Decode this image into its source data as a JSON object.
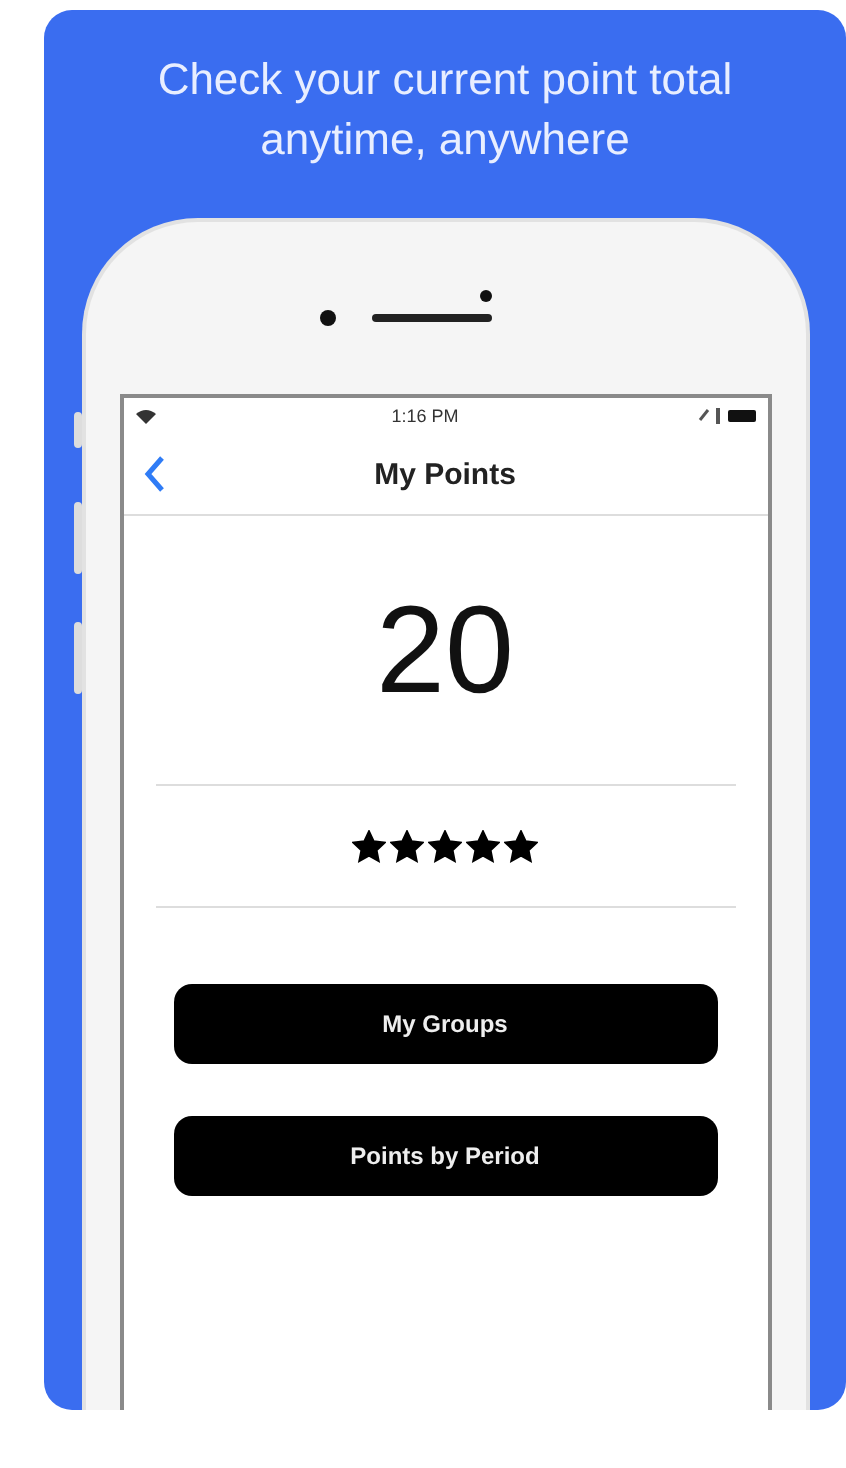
{
  "headline": "Check your current point total anytime, anywhere",
  "status_bar": {
    "time": "1:16 PM"
  },
  "nav": {
    "title": "My Points"
  },
  "points": "20",
  "rating": {
    "stars": 5
  },
  "buttons": [
    "My Groups",
    "Points by Period"
  ]
}
